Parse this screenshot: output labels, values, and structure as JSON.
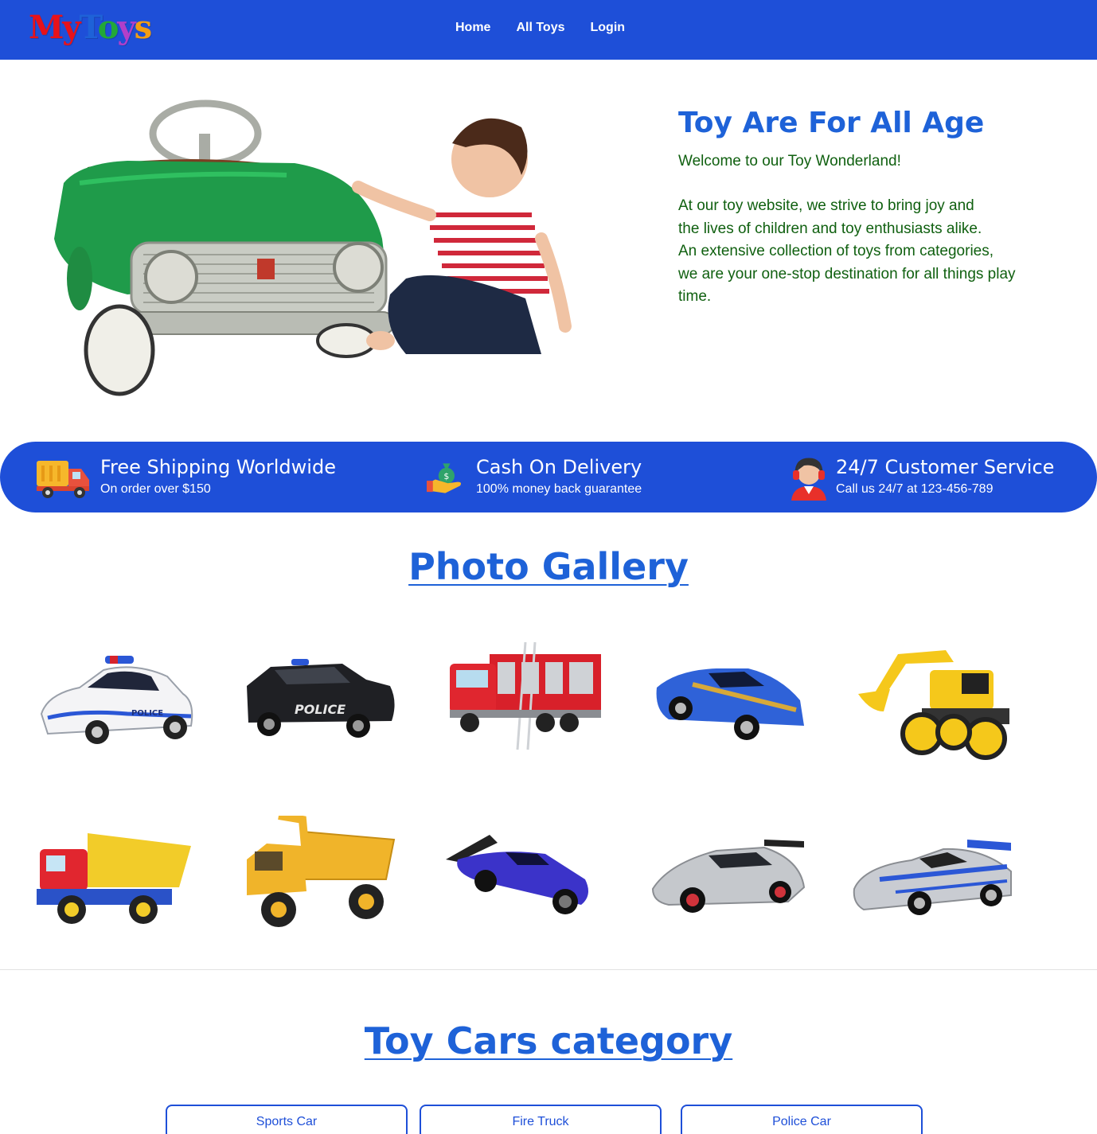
{
  "navbar": {
    "logo": [
      "M",
      "y",
      "T",
      "o",
      "y",
      "s"
    ],
    "logo_colors": [
      "#e8121a",
      "#e8121a",
      "#1e62d8",
      "#22a838",
      "#b23fc9",
      "#f29d14"
    ],
    "links": [
      {
        "label": "Home"
      },
      {
        "label": "All Toys"
      },
      {
        "label": "Login"
      }
    ]
  },
  "hero": {
    "title": "Toy Are For All Age",
    "welcome": "Welcome to our Toy Wonderland!",
    "body_lines": [
      "At our toy website, we strive to bring joy and",
      "the lives of children and toy enthusiasts alike.",
      "An extensive collection of toys from categories,",
      "we are your one-stop destination for all things play",
      "time."
    ],
    "image": "child-with-green-pedal-car-photo"
  },
  "features": [
    {
      "icon": "delivery-truck-icon",
      "title": "Free Shipping Worldwide",
      "subtitle": "On order over $150"
    },
    {
      "icon": "money-hand-icon",
      "title": "Cash On Delivery",
      "subtitle": "100% money back guarantee"
    },
    {
      "icon": "headset-agent-icon",
      "title": "24/7 Customer Service",
      "subtitle": "Call us 24/7 at 123-456-789"
    }
  ],
  "gallery": {
    "title": "Photo Gallery",
    "items": [
      {
        "name": "police-car-white",
        "text": "POLICE"
      },
      {
        "name": "police-suv-black",
        "text": "POLICE"
      },
      {
        "name": "fire-truck-red",
        "text": ""
      },
      {
        "name": "sports-car-blue",
        "text": ""
      },
      {
        "name": "excavator-yellow",
        "text": ""
      },
      {
        "name": "dump-truck-red-yellow",
        "text": ""
      },
      {
        "name": "dump-truck-yellow",
        "text": ""
      },
      {
        "name": "race-car-purple",
        "text": ""
      },
      {
        "name": "supercar-silver",
        "text": ""
      },
      {
        "name": "nissan-gtr-silver-blue",
        "text": ""
      }
    ]
  },
  "category": {
    "title": "Toy Cars category",
    "tabs": [
      {
        "label": "Sports Car"
      },
      {
        "label": "Fire Truck"
      },
      {
        "label": "Police Car"
      }
    ]
  },
  "colors": {
    "brand_blue": "#1e4fd8",
    "title_blue": "#1e62d8",
    "text_green": "#106010"
  }
}
